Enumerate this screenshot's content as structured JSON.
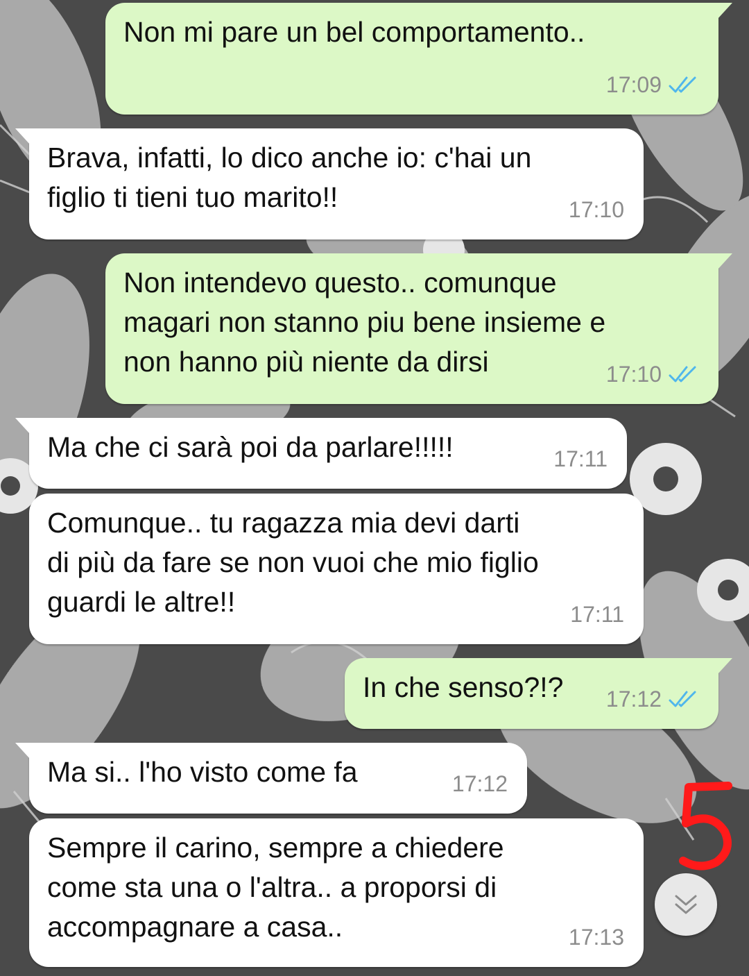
{
  "messages": [
    {
      "dir": "out",
      "text": "Non mi pare un bel comportamento..",
      "time": "17:09",
      "read": true
    },
    {
      "dir": "in",
      "text": "Brava, infatti, lo dico anche io: c'hai un\nfiglio ti tieni tuo marito!!",
      "time": "17:10"
    },
    {
      "dir": "out",
      "text": "Non intendevo questo.. comunque\nmagari non stanno piu bene insieme e\nnon hanno più niente da dirsi",
      "time": "17:10",
      "read": true
    },
    {
      "dir": "in",
      "text": "Ma che ci sarà poi da parlare!!!!!",
      "time": "17:11"
    },
    {
      "dir": "in",
      "text": "Comunque.. tu ragazza mia devi darti\ndi più da fare se non vuoi che mio figlio\nguardi le altre!!",
      "time": "17:11"
    },
    {
      "dir": "out",
      "text": "In che senso?!?",
      "time": "17:12",
      "read": true
    },
    {
      "dir": "in",
      "text": "Ma si.. l'ho visto come fa",
      "time": "17:12"
    },
    {
      "dir": "in",
      "text": "Sempre il carino, sempre a chiedere\ncome sta una o l'altra.. a proporsi di\naccompagnare a casa..",
      "time": "17:13"
    }
  ],
  "colors": {
    "outgoing_bubble": "#dcf8c6",
    "incoming_bubble": "#ffffff",
    "timestamp": "#8c8c8c",
    "read_ticks": "#4fb6ec",
    "annotation": "#ff1a1a"
  },
  "icons": {
    "read_receipt": "double-check-icon",
    "scroll_down": "double-chevron-down-icon"
  }
}
